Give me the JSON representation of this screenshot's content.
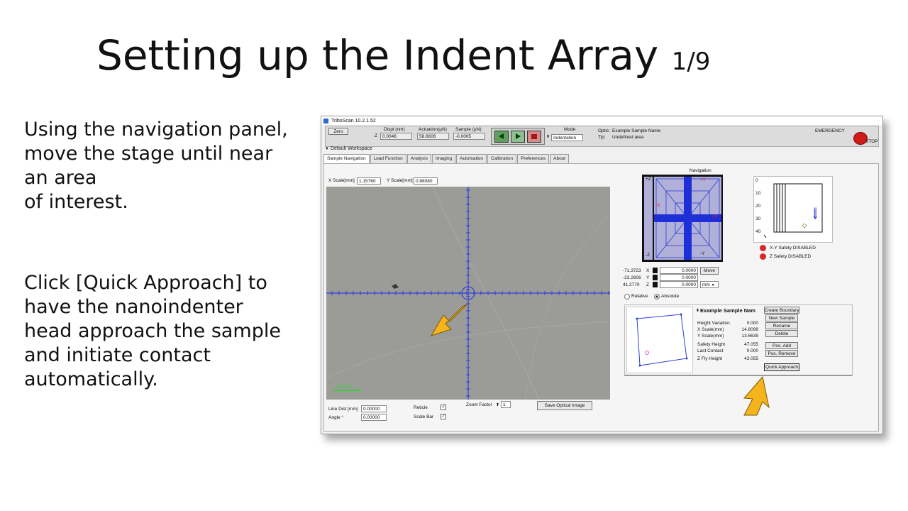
{
  "slide": {
    "title": "Setting up the Indent Array",
    "title_suffix": "1/9",
    "para1_lines": [
      "Using the navigation panel,",
      "move the stage until near",
      "an area",
      "of interest."
    ],
    "para2_lines": [
      "Click [Quick Approach] to",
      "have the nanoindenter",
      "head approach the sample",
      "and initiate contact",
      "automatically."
    ]
  },
  "app": {
    "title": "TriboScan 10.2.1.52",
    "zero_label": "Zero",
    "displ_header": "Displ (nm)",
    "actuation_header": "Actuation(µN)",
    "sample_header": "Sample (µN)",
    "z_label": "Z",
    "displ_value": "0.0046",
    "actuation_value": "58.6606",
    "sample_value": "-0.0005",
    "mode_label": "Mode",
    "mode_value": "Indentation",
    "optic_label": "Optic:",
    "optic_value": "Example Sample Name",
    "tip_label": "Tip:",
    "tip_value": "Undefined area",
    "emergency_label": "EMERGENCY",
    "stop_label": "STOP",
    "workspace": "Default Workspace",
    "tabs": [
      "Sample Navigation",
      "Load Function",
      "Analysis",
      "Imaging",
      "Automation",
      "Calibration",
      "Preferences",
      "About"
    ],
    "xscale_label": "X Scale[mm]",
    "xscale_value": "1.15760",
    "yscale_label": "Y Scale[mm]",
    "yscale_value": "0.88080",
    "scalebar_text": "100 µm",
    "line_dist_label": "Line Dist [mm]",
    "line_dist_value": "0.00000",
    "angle_label": "Angle °",
    "angle_value": "0.00000",
    "reticle_label": "Reticle",
    "scalebar_label": "Scale Bar",
    "zoom_label": "Zoom Factor",
    "zoom_value": "1",
    "save_image_label": "Save Optical Image",
    "navigation_title": "Navigation",
    "nav_plus_y": "+Y",
    "nav_minus_y": "-Y",
    "nav_plus_x": "+X",
    "nav_minus_x": "-X",
    "nav_plus_z": "+Z",
    "nav_minus_z": "-Z",
    "depth_ticks": [
      "0",
      "10",
      "20",
      "30",
      "40"
    ],
    "xy_safety": "X-Y Safety DISABLED",
    "z_safety": "Z  Safety DISABLED",
    "x_pos": "-71.3723",
    "y_pos": "-23.2806",
    "z_pos": "41.2770",
    "x_axis": "X",
    "y_axis": "Y",
    "z_axis": "Z",
    "move_x": "0.0000",
    "move_y": "0.0000",
    "move_z": "0.0000",
    "move_label": "Move",
    "unit_value": "mm",
    "relative_label": "Relative",
    "absolute_label": "Absolute",
    "sample_name": "Example Sample Nam",
    "height_variation_label": "Height Variation",
    "height_variation_value": "0.000",
    "xscale_mm_label": "X Scale(mm)",
    "xscale_mm_value": "14.8099",
    "yscale_mm_label": "Y Scale(mm)",
    "yscale_mm_value": "13.6639",
    "safety_height_label": "Safety Height",
    "safety_height_value": "47.055",
    "last_contact_label": "Last Contact",
    "last_contact_value": "0.000",
    "zfly_label": "Z Fly Height",
    "zfly_value": "43.055",
    "create_boundary_label": "Create Boundary",
    "new_sample_label": "New Sample",
    "rename_label": "Rename",
    "delete_label": "Delete",
    "pos_add_label": "Pos. Add",
    "pos_remove_label": "Pos. Remove",
    "quick_approach_label": "Quick Approach"
  },
  "colors": {
    "arrow": "#f5b41c",
    "reticle": "#2f3fd8",
    "nav_fill": "#b0b0d8",
    "safety_red": "#d8282a"
  }
}
